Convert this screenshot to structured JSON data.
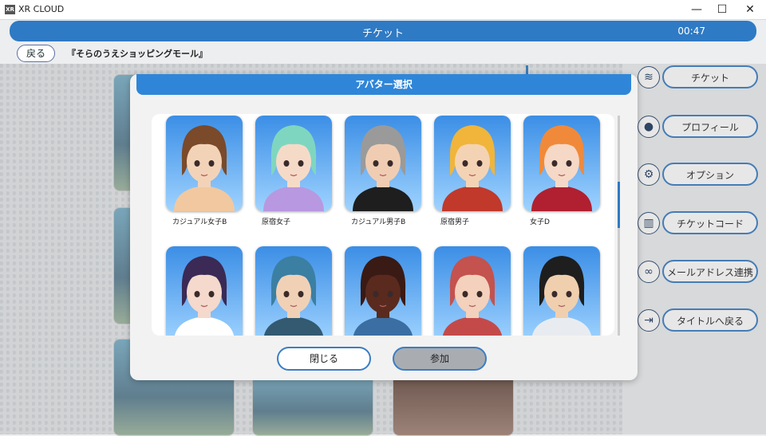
{
  "window": {
    "app_title": "XR CLOUD",
    "logo_text": "XR",
    "minimize": "—",
    "maximize": "☐",
    "close": "✕"
  },
  "topbar": {
    "title": "チケット",
    "timer": "00:47"
  },
  "nav": {
    "back_label": "戻る",
    "location": "『そらのうえショッピングモール』"
  },
  "side_menu": [
    {
      "label": "チケット",
      "icon": "ticket-icon",
      "glyph": "≋"
    },
    {
      "label": "プロフィール",
      "icon": "profile-icon",
      "glyph": "●"
    },
    {
      "label": "オプション",
      "icon": "gear-icon",
      "glyph": "⚙"
    },
    {
      "label": "チケットコード",
      "icon": "barcode-icon",
      "glyph": "▥"
    },
    {
      "label": "メールアドレス連携",
      "icon": "link-icon",
      "glyph": "∞"
    },
    {
      "label": "タイトルへ戻る",
      "icon": "exit-icon",
      "glyph": "⇥"
    }
  ],
  "modal": {
    "title": "アバター選択",
    "avatars": [
      {
        "name": "カジュアル女子B"
      },
      {
        "name": "原宿女子"
      },
      {
        "name": "カジュアル男子B"
      },
      {
        "name": "原宿男子"
      },
      {
        "name": "女子D"
      },
      {
        "name": ""
      },
      {
        "name": ""
      },
      {
        "name": ""
      },
      {
        "name": ""
      },
      {
        "name": ""
      }
    ],
    "close_label": "閉じる",
    "join_label": "参加"
  },
  "colors": {
    "accent": "#2f7ac4",
    "header": "#2f86d8"
  }
}
